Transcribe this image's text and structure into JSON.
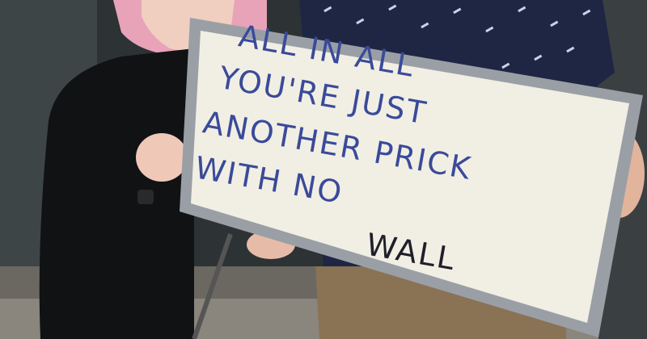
{
  "sign": {
    "lines": [
      "ALL IN ALL",
      "YOU'RE JUST",
      "ANOTHER PRICK",
      "WITH NO",
      "WALL"
    ]
  },
  "colors": {
    "ink_blue": "#3a4a9a",
    "ink_black": "#1f1f2a",
    "board": "#f1eee4",
    "tape": "#9a9fa6",
    "hair": "#e8a3b8",
    "skin": "#f0cfc0",
    "jacket": "#111214",
    "shirt": "#1e2644",
    "trousers": "#8a7254",
    "background_glass": "#3a4143"
  }
}
